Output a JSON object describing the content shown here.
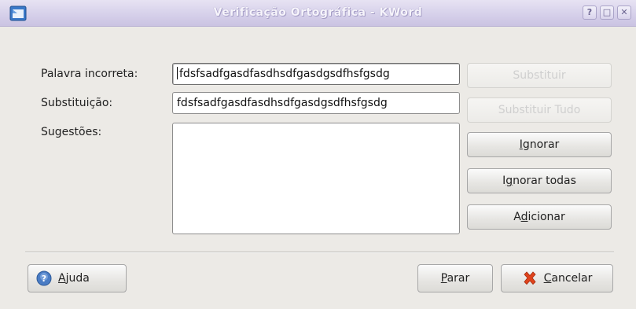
{
  "window": {
    "title": "Verificação Ortográfica - KWord",
    "buttons": {
      "help": "?",
      "maximize": "□",
      "close": "✕"
    }
  },
  "form": {
    "misspelled_label": "Palavra incorreta:",
    "misspelled_value": "fdsfsadfgasdfasdhsdfgasdgsdfhsfgsdg",
    "replacement_label": "Substituição:",
    "replacement_value": "fdsfsadfgasdfasdhsdfgasdgsdfhsfgsdg",
    "suggestions_label": "Sugestões:",
    "suggestions": []
  },
  "actions": {
    "replace": "Substituir",
    "replace_all": "Substituir Tudo",
    "ignore": {
      "mnemonic": "I",
      "rest": "gnorar"
    },
    "ignore_all": {
      "pre": "I",
      "mnemonic": "g",
      "rest": "norar todas"
    },
    "add": {
      "pre": "A",
      "mnemonic": "d",
      "rest": "icionar"
    }
  },
  "footer": {
    "help": {
      "mnemonic": "A",
      "rest": "juda"
    },
    "stop": {
      "mnemonic": "P",
      "rest": "arar"
    },
    "cancel": {
      "mnemonic": "C",
      "rest": "ancelar"
    }
  },
  "icons": {
    "app": "kword-app-icon",
    "help": "help-icon",
    "cancel": "cancel-x-icon"
  }
}
